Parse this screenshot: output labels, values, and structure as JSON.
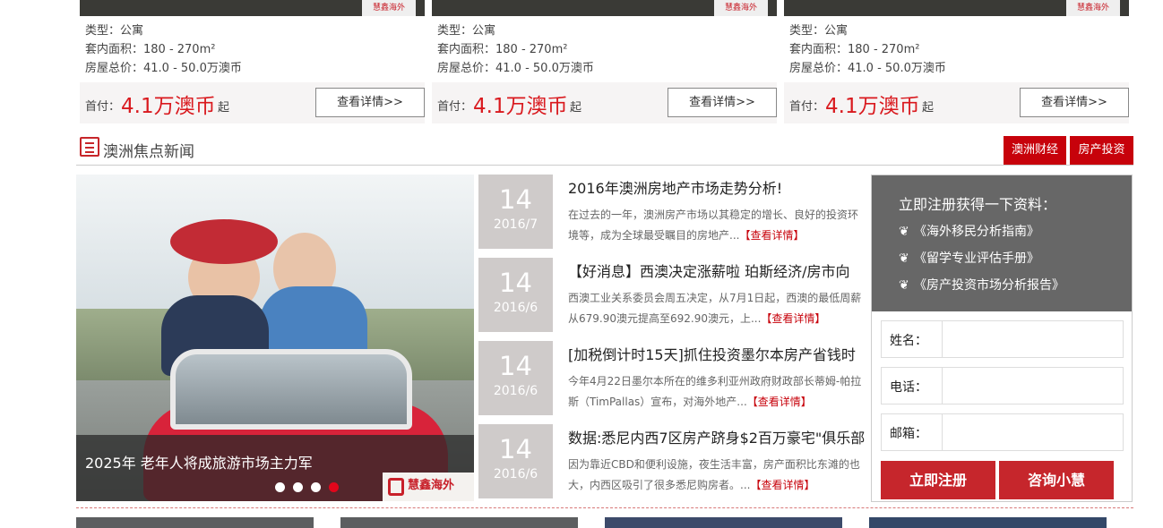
{
  "cards": [
    {
      "type": "类型：公寓",
      "area": "套内面积：180 - 270m²",
      "price": "房屋总价：41.0 - 50.0万澳币",
      "pay_label": "首付：",
      "pay_amount": "4.1万澳币",
      "pay_suffix": "起",
      "detail": "查看详情>>"
    },
    {
      "type": "类型：公寓",
      "area": "套内面积：180 - 270m²",
      "price": "房屋总价：41.0 - 50.0万澳币",
      "pay_label": "首付：",
      "pay_amount": "4.1万澳币",
      "pay_suffix": "起",
      "detail": "查看详情>>"
    },
    {
      "type": "类型：公寓",
      "area": "套内面积：180 - 270m²",
      "price": "房屋总价：41.0 - 50.0万澳币",
      "pay_label": "首付：",
      "pay_amount": "4.1万澳币",
      "pay_suffix": "起",
      "detail": "查看详情>>"
    }
  ],
  "logo_text": "慧鑫海外",
  "section": {
    "title": "澳洲焦点新闻",
    "tags": [
      "澳洲财经",
      "房产投资"
    ]
  },
  "slider": {
    "caption": "2025年 老年人将成旅游市场主力军",
    "dots": 4,
    "active": 3,
    "logo": "慧鑫海外"
  },
  "news": [
    {
      "day": "14",
      "ym": "2016/7",
      "title": "2016年澳洲房地产市场走势分析!",
      "desc": "在过去的一年，澳洲房产市场以其稳定的增长、良好的投资环境等，成为全球最受瞩目的房地产...",
      "more": "【查看详情】"
    },
    {
      "day": "14",
      "ym": "2016/6",
      "title": "【好消息】西澳决定涨薪啦 珀斯经济/房市向",
      "desc": "西澳工业关系委员会周五决定，从7月1日起，西澳的最低周薪从679.90澳元提高至692.90澳元，上...",
      "more": "【查看详情】"
    },
    {
      "day": "14",
      "ym": "2016/6",
      "title": "[加税倒计时15天]抓住投资墨尔本房产省钱时",
      "desc": "今年4月22日墨尔本所在的维多利亚州政府财政部长蒂姆-帕拉斯（TimPallas）宣布，对海外地产...",
      "more": "【查看详情】"
    },
    {
      "day": "14",
      "ym": "2016/6",
      "title": "数据:悉尼内西7区房产跻身$2百万豪宅\"俱乐部",
      "desc": "因为靠近CBD和便利设施，夜生活丰富，房产面积比东滩的也大，内西区吸引了很多悉尼购房者。...",
      "more": "【查看详情】"
    }
  ],
  "register": {
    "title": "立即注册获得一下资料：",
    "items": [
      "《海外移民分析指南》",
      "《留学专业评估手册》",
      "《房产投资市场分析报告》"
    ],
    "fields": [
      "姓名：",
      "电话：",
      "邮箱："
    ],
    "submit": "立即注册",
    "consult": "咨询小慧"
  }
}
